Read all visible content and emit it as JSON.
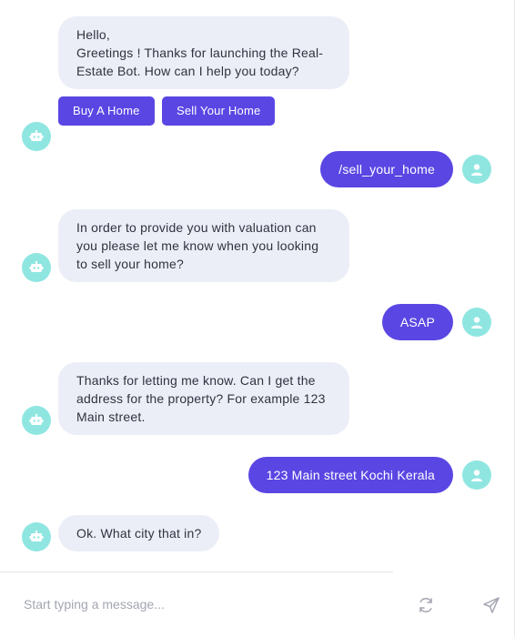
{
  "messages": {
    "bot_greeting_line1": "Hello,",
    "bot_greeting_line2": "Greetings ! Thanks for launching the Real-Estate Bot. How can I help you today?",
    "quick_replies": [
      "Buy A Home",
      "Sell Your Home"
    ],
    "user_1": "/sell_your_home",
    "bot_2": "In order to provide you with valuation can you please let me know when you looking to sell your home?",
    "user_2": "ASAP",
    "bot_3": "Thanks for letting me know. Can I get the address for the property? For example 123 Main street.",
    "user_3": "123 Main street Kochi Kerala",
    "bot_4": "Ok. What city that in?"
  },
  "composer": {
    "placeholder": "Start typing a message..."
  },
  "icons": {
    "bot_avatar": "robot-icon",
    "user_avatar": "user-icon",
    "refresh": "refresh-icon",
    "send": "send-icon"
  },
  "colors": {
    "accent": "#5a46e3",
    "bot_bubble": "#eceef7",
    "avatar_bg": "#8fe6e1"
  }
}
